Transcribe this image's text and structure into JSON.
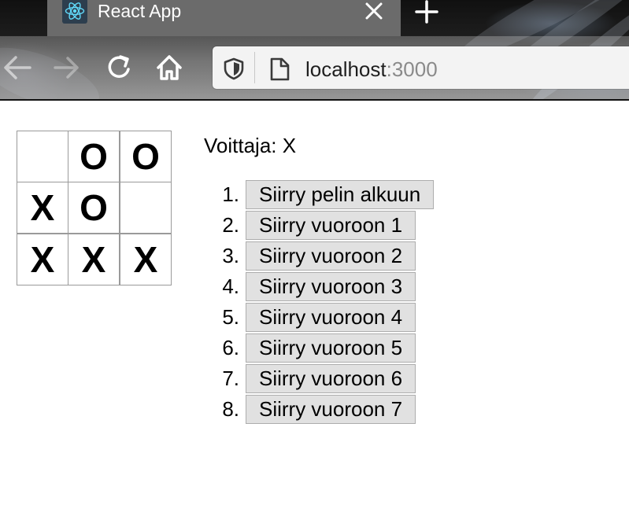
{
  "browser": {
    "tab_title": "React App",
    "url_host": "localhost",
    "url_port": ":3000",
    "icons": [
      "react-favicon",
      "close-icon",
      "plus-icon",
      "back-arrow-icon",
      "forward-arrow-icon",
      "reload-icon",
      "home-icon",
      "shield-icon",
      "page-icon"
    ]
  },
  "game": {
    "status": "Voittaja: X",
    "board": [
      "",
      "O",
      "O",
      "X",
      "O",
      "",
      "X",
      "X",
      "X"
    ]
  },
  "moves": [
    {
      "num": "1.",
      "label": "Siirry pelin alkuun"
    },
    {
      "num": "2.",
      "label": "Siirry vuoroon 1"
    },
    {
      "num": "3.",
      "label": "Siirry vuoroon 2"
    },
    {
      "num": "4.",
      "label": "Siirry vuoroon 3"
    },
    {
      "num": "5.",
      "label": "Siirry vuoroon 4"
    },
    {
      "num": "6.",
      "label": "Siirry vuoroon 5"
    },
    {
      "num": "7.",
      "label": "Siirry vuoroon 6"
    },
    {
      "num": "8.",
      "label": "Siirry vuoroon 7"
    }
  ],
  "colors": {
    "tab_bg": "#6b6b6b",
    "urlbar_bg": "#f3f3f3",
    "button_bg": "#e1e1e1",
    "square_border": "#9a9a9a"
  }
}
